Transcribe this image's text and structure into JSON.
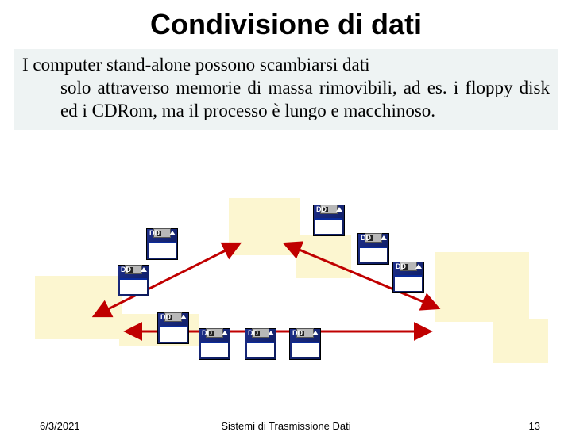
{
  "title": "Condivisione di dati",
  "body_first": "I computer stand-alone possono scambiarsi dati",
  "body_rest": "solo attraverso memorie di massa rimovibili, ad es. i floppy disk ed i CDRom, ma il processo è lungo e macchinoso.",
  "floppy_label": "DD",
  "footer": {
    "date": "6/3/2021",
    "title": "Sistemi di Trasmissione Dati",
    "page": "13"
  },
  "colors": {
    "box_fill": "#fcf6d0",
    "arrow": "#c00000",
    "floppy": "#102a8a"
  }
}
